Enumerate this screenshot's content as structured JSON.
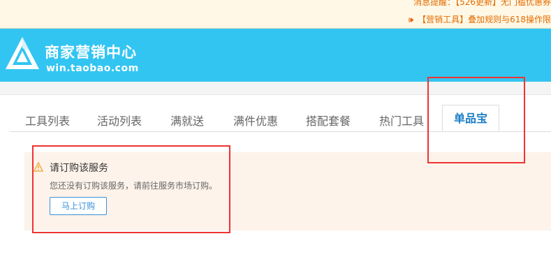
{
  "notices": {
    "line1": "消息提醒：【526更新】无门槛优惠券",
    "line2": "【营销工具】叠加规则与618操作限",
    "speaker_icon": "speaker-icon"
  },
  "brand": {
    "title": "商家营销中心",
    "subtitle": "win.taobao.com",
    "header_color": "#33c5f2"
  },
  "tabs": [
    {
      "label": "工具列表"
    },
    {
      "label": "活动列表"
    },
    {
      "label": "满就送"
    },
    {
      "label": "满件优惠"
    },
    {
      "label": "搭配套餐"
    },
    {
      "label": "热门工具"
    },
    {
      "label": "单品宝",
      "active": true
    }
  ],
  "alert": {
    "title": "请订购该服务",
    "desc": "您还没有订购该服务，请前往服务市场订购。",
    "button": "马上订购",
    "icon": "warning-icon"
  },
  "colors": {
    "highlight": "#ee3333",
    "alert_bg": "#fdf3ea",
    "active_tab": "#1d7fc6"
  }
}
